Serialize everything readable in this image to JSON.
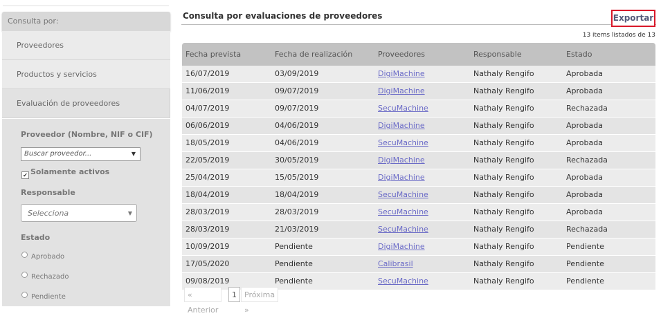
{
  "sidebar": {
    "header": "Consulta por:",
    "items": [
      {
        "label": "Proveedores"
      },
      {
        "label": "Productos y servicios"
      },
      {
        "label": "Evaluación de proveedores"
      }
    ],
    "filters": {
      "provider_label": "Proveedor (Nombre, NIF o CIF)",
      "provider_placeholder": "Buscar proveedor...",
      "only_active_label": "Solamente activos",
      "only_active_checked": true,
      "responsable_label": "Responsable",
      "responsable_value": "Selecciona",
      "estado_label": "Estado",
      "estado_options": [
        "Aprobado",
        "Rechazado",
        "Pendiente"
      ]
    }
  },
  "main": {
    "title": "Consulta por evaluaciones de proveedores",
    "export_label": "Exportar",
    "count_text": "13 items listados de 13",
    "columns": [
      "Fecha prevista",
      "Fecha de realización",
      "Proveedores",
      "Responsable",
      "Estado"
    ],
    "rows": [
      [
        "16/07/2019",
        "03/09/2019",
        "DigiMachine",
        "Nathaly Rengifo",
        "Aprobada"
      ],
      [
        "11/06/2019",
        "09/07/2019",
        "DigiMachine",
        "Nathaly Rengifo",
        "Aprobada"
      ],
      [
        "04/07/2019",
        "09/07/2019",
        "SecuMachine",
        "Nathaly Rengifo",
        "Rechazada"
      ],
      [
        "06/06/2019",
        "04/06/2019",
        "DigiMachine",
        "Nathaly Rengifo",
        "Aprobada"
      ],
      [
        "18/05/2019",
        "04/06/2019",
        "SecuMachine",
        "Nathaly Rengifo",
        "Aprobada"
      ],
      [
        "22/05/2019",
        "30/05/2019",
        "DigiMachine",
        "Nathaly Rengifo",
        "Rechazada"
      ],
      [
        "25/04/2019",
        "15/05/2019",
        "DigiMachine",
        "Nathaly Rengifo",
        "Aprobada"
      ],
      [
        "18/04/2019",
        "18/04/2019",
        "SecuMachine",
        "Nathaly Rengifo",
        "Aprobada"
      ],
      [
        "28/03/2019",
        "28/03/2019",
        "SecuMachine",
        "Nathaly Rengifo",
        "Aprobada"
      ],
      [
        "28/03/2019",
        "21/03/2019",
        "SecuMachine",
        "Nathaly Rengifo",
        "Rechazada"
      ],
      [
        "10/09/2019",
        "Pendiente",
        "DigiMachine",
        "Nathaly Rengifo",
        "Pendiente"
      ],
      [
        "17/05/2020",
        "Pendiente",
        "Calibrasil",
        "Nathaly Rengifo",
        "Pendiente"
      ],
      [
        "09/08/2019",
        "Pendiente",
        "SecuMachine",
        "Nathaly Rengifo",
        "Pendiente"
      ]
    ],
    "pagination": {
      "prev_label": "« Anterior",
      "current_page": "1",
      "next_label": "Próxima »"
    }
  },
  "colors": {
    "export_border": "#d9182a",
    "link": "#6b6bc7",
    "header_bg": "#c2c2c2"
  }
}
